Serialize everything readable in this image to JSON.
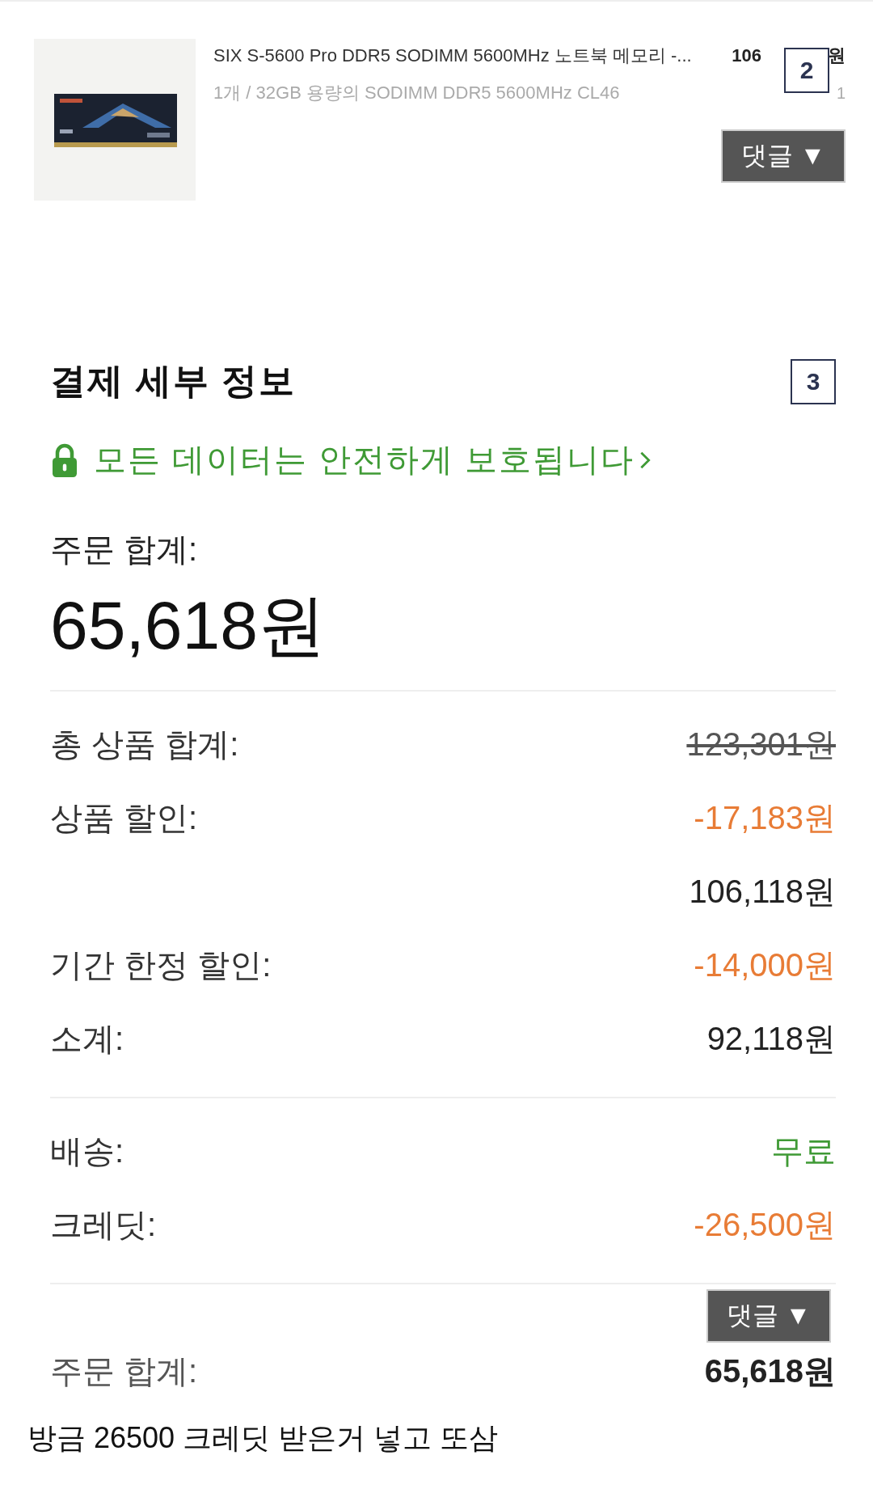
{
  "item": {
    "kind": "picture",
    "title": "SIX S-5600 Pro DDR5 SODIMM 5600MHz 노트북 메모리 -...",
    "price_parts": [
      "106",
      "원"
    ],
    "option": "1개 / 32GB 용량의 SODIMM DDR5 5600MHz CL46",
    "quantity": "1",
    "marker": "2",
    "comment_button": "댓글 ▼"
  },
  "payment": {
    "title": "결제 세부 정보",
    "marker": "3",
    "secure_note": "모든 데이터는 안전하게 보호됩니다",
    "total_label": "주문 합계:",
    "total_value": "65,618원",
    "groups": [
      [
        {
          "label": "총 상품 합계:",
          "value": "123,301원",
          "kind": "normal",
          "struck": true
        },
        {
          "label": "상품 할인:",
          "value": "-17,183원",
          "kind": "discount",
          "struck": false
        },
        {
          "value": "106,118원",
          "kind": "normal",
          "struck": false
        },
        {
          "label": "기간 한정 할인:",
          "value": "-14,000원",
          "kind": "discount",
          "struck": false
        },
        {
          "label": "소계:",
          "value": "92,118원",
          "kind": "normal",
          "struck": false
        }
      ],
      [
        {
          "label": "배송:",
          "value": "무료",
          "kind": "free",
          "struck": false
        },
        {
          "label": "크레딧:",
          "value": "-26,500원",
          "kind": "discount",
          "struck": false
        }
      ]
    ],
    "footer_label": "주문 합계:",
    "footer_value": "65,618원",
    "comment_button": "댓글 ▼"
  },
  "caption": "방금 26500 크레딧 받은거 넣고 또삼"
}
